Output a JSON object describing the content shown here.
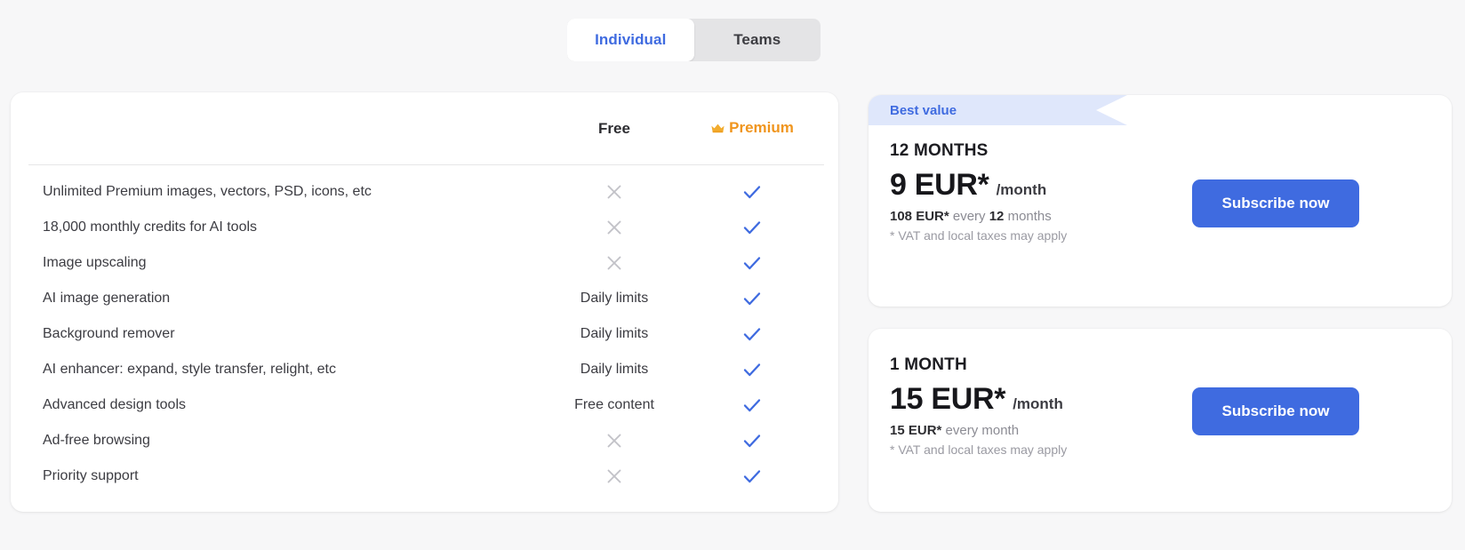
{
  "colors": {
    "background": "#f7f7f8",
    "accent_blue": "#3f6be0",
    "premium_orange": "#f0951e",
    "ribbon_bg": "#dfe7fb",
    "x_gray": "#c2c2c8",
    "card_white": "#ffffff"
  },
  "toggle": {
    "options": [
      {
        "label": "Individual",
        "active": true
      },
      {
        "label": "Teams",
        "active": false
      }
    ]
  },
  "comparison_table": {
    "columns": [
      {
        "key": "feature",
        "label": ""
      },
      {
        "key": "free",
        "label": "Free"
      },
      {
        "key": "premium",
        "label": "Premium",
        "icon": "crown-icon"
      }
    ],
    "rows": [
      {
        "feature": "Unlimited Premium images, vectors, PSD, icons, etc",
        "free": "x-icon",
        "premium": "check-icon"
      },
      {
        "feature": "18,000 monthly credits for AI tools",
        "free": "x-icon",
        "premium": "check-icon"
      },
      {
        "feature": "Image upscaling",
        "free": "x-icon",
        "premium": "check-icon"
      },
      {
        "feature": "AI image generation",
        "free": "Daily limits",
        "premium": "check-icon"
      },
      {
        "feature": "Background remover",
        "free": "Daily limits",
        "premium": "check-icon"
      },
      {
        "feature": "AI enhancer: expand, style transfer, relight, etc",
        "free": "Daily limits",
        "premium": "check-icon"
      },
      {
        "feature": "Advanced design tools",
        "free": "Free content",
        "premium": "check-icon"
      },
      {
        "feature": "Ad-free browsing",
        "free": "x-icon",
        "premium": "check-icon"
      },
      {
        "feature": "Priority support",
        "free": "x-icon",
        "premium": "check-icon"
      }
    ]
  },
  "plans": [
    {
      "badge": "Best value",
      "term": "12 MONTHS",
      "price": "9 EUR*",
      "per": "/month",
      "billing_amount": "108 EUR*",
      "billing_mid": " every ",
      "billing_count": "12",
      "billing_unit": " months",
      "vat_note": "* VAT and local taxes may apply",
      "cta": "Subscribe now"
    },
    {
      "term": "1 MONTH",
      "price": "15 EUR*",
      "per": "/month",
      "billing_amount": "15 EUR*",
      "billing_mid": " every month",
      "billing_count": "",
      "billing_unit": "",
      "vat_note": "* VAT and local taxes may apply",
      "cta": "Subscribe now"
    }
  ]
}
